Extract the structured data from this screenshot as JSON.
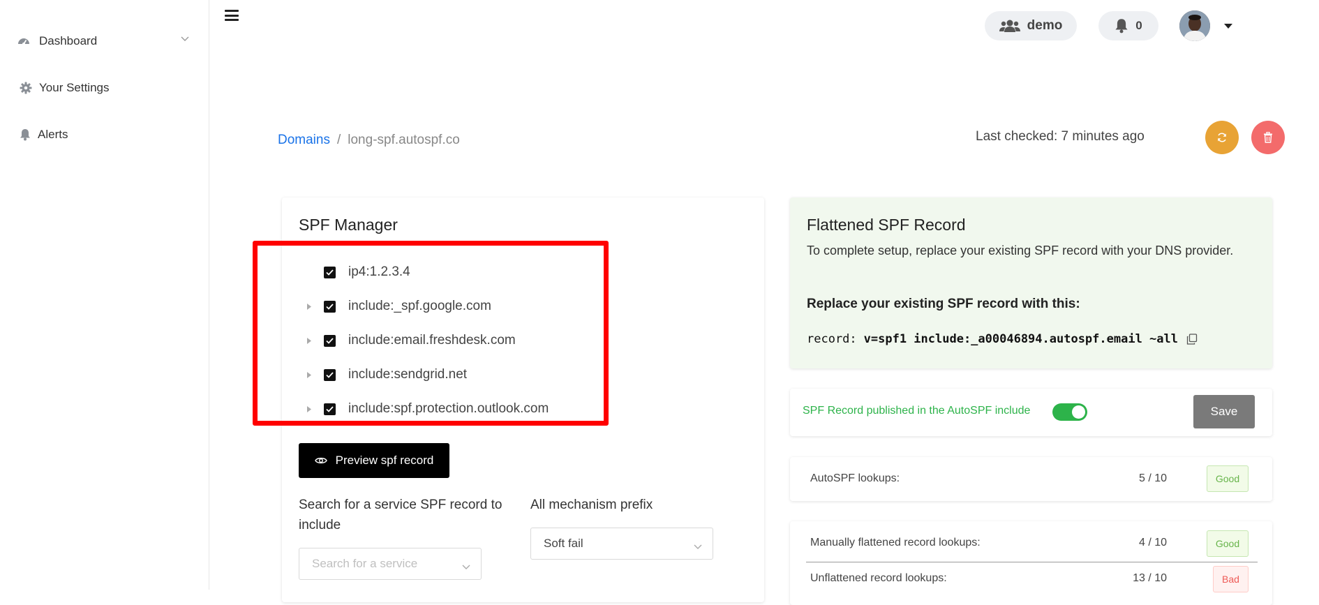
{
  "sidebar": {
    "items": [
      {
        "label": "Dashboard",
        "icon": "dashboard-icon"
      },
      {
        "label": "Your Settings",
        "icon": "gear-icon"
      },
      {
        "label": "Alerts",
        "icon": "bell-icon"
      }
    ]
  },
  "header": {
    "account_label": "demo",
    "notifications_count": "0"
  },
  "breadcrumb": {
    "root": "Domains",
    "separator": "/",
    "current": "long-spf.autospf.co"
  },
  "status": {
    "last_checked": "Last checked: 7 minutes ago"
  },
  "colors": {
    "refresh_button": "#e8a335",
    "delete_button": "#f36b6b",
    "link": "#1a73e8",
    "success": "#2db34a",
    "annotation_frame": "#ff0000"
  },
  "spf_manager": {
    "title": "SPF Manager",
    "mechanisms": [
      {
        "label": "ip4:1.2.3.4",
        "checked": true,
        "expandable": false
      },
      {
        "label": "include:_spf.google.com",
        "checked": true,
        "expandable": true
      },
      {
        "label": "include:email.freshdesk.com",
        "checked": true,
        "expandable": true
      },
      {
        "label": "include:sendgrid.net",
        "checked": true,
        "expandable": true
      },
      {
        "label": "include:spf.protection.outlook.com",
        "checked": true,
        "expandable": true
      }
    ],
    "preview_button": "Preview spf record",
    "search_label": "Search for a service SPF record to include",
    "search_placeholder": "Search for a service",
    "prefix_label": "All mechanism prefix",
    "prefix_value": "Soft fail"
  },
  "flattened": {
    "title": "Flattened SPF Record",
    "description": "To complete setup, replace your existing SPF record with your DNS provider.",
    "replace_heading": "Replace your existing SPF record with this:",
    "record_key": "record:",
    "record_value": "v=spf1 include:_a00046894.autospf.email ~all"
  },
  "publish": {
    "label": "SPF Record published in the AutoSPF include",
    "enabled": true,
    "save_label": "Save"
  },
  "lookups": {
    "autospf": {
      "label": "AutoSPF lookups:",
      "value": "5 / 10",
      "status": "Good"
    },
    "manual": {
      "label": "Manually flattened record lookups:",
      "value": "4 / 10",
      "status": "Good"
    },
    "unflattened": {
      "label": "Unflattened record lookups:",
      "value": "13 / 10",
      "status": "Bad"
    }
  }
}
